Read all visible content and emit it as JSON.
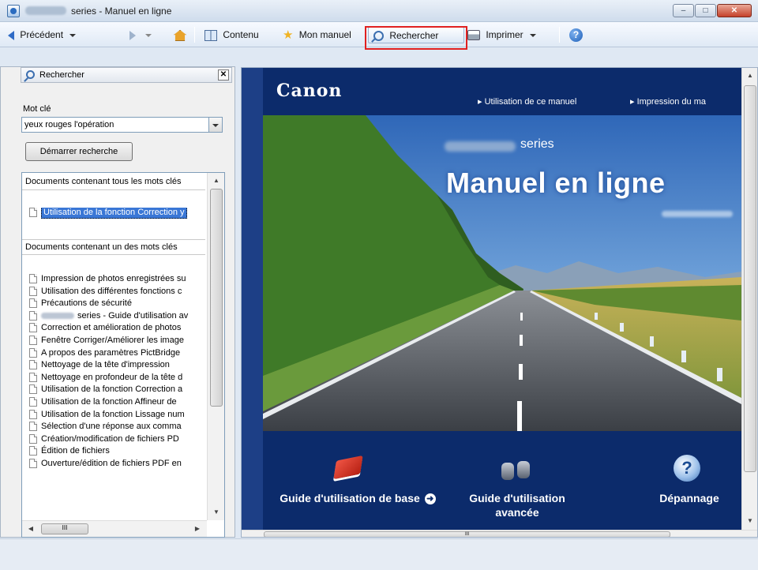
{
  "window": {
    "title": "series - Manuel en ligne",
    "min_glyph": "–",
    "max_glyph": "□",
    "close_glyph": "✕"
  },
  "toolbar": {
    "back_label": "Précédent",
    "contents_label": "Contenu",
    "my_manual_label": "Mon manuel",
    "search_label": "Rechercher",
    "print_label": "Imprimer",
    "help_glyph": "?"
  },
  "search_pane": {
    "title": "Rechercher",
    "close_glyph": "✕",
    "keyword_label": "Mot clé",
    "keyword_value": "yeux rouges l'opération",
    "start_button": "Démarrer recherche",
    "section_all": "Documents contenant tous les mots clés",
    "selected_result": "Utilisation de la fonction Correction y",
    "section_any": "Documents contenant un des mots clés",
    "results": [
      "Impression de photos enregistrées su",
      "Utilisation des différentes fonctions c",
      "Précautions de sécurité",
      "series - Guide d'utilisation av",
      "Correction et amélioration de photos",
      "Fenêtre Corriger/Améliorer les image",
      "A propos des paramètres PictBridge",
      "Nettoyage de la tête d'impression",
      "Nettoyage en profondeur de la tête d",
      "Utilisation de la fonction Correction a",
      "Utilisation de la fonction Affineur de",
      "Utilisation de la fonction Lissage num",
      "Sélection d'une réponse aux comma",
      "Création/modification de fichiers PD",
      "Édition de fichiers",
      "Ouverture/édition de fichiers PDF en"
    ],
    "scroll_thumb_glyph": "III"
  },
  "manual_page": {
    "brand": "Canon",
    "link_usage": "Utilisation de ce manuel",
    "link_print": "Impression du ma",
    "series_label": "series",
    "title": "Manuel en ligne",
    "nav_basic": "Guide d'utilisation de base",
    "nav_advanced": "Guide d'utilisation avancée",
    "nav_trouble": "Dépannage",
    "scroll_thumb_glyph": "III"
  }
}
